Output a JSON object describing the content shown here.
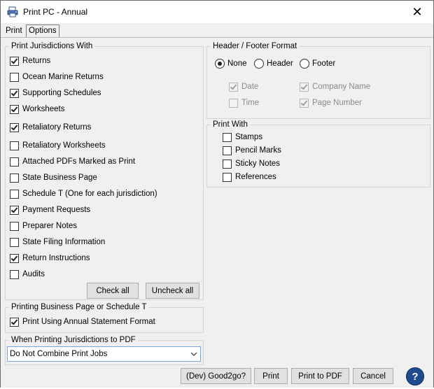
{
  "window": {
    "title": "Print PC - Annual"
  },
  "tabs": [
    {
      "label": "Print"
    },
    {
      "label": "Options"
    }
  ],
  "jurisdictions": {
    "title": "Print Jurisdictions With",
    "items": [
      {
        "label": "Returns",
        "checked": true
      },
      {
        "label": "Ocean Marine Returns",
        "checked": false
      },
      {
        "label": "Supporting Schedules",
        "checked": true
      },
      {
        "label": "Worksheets",
        "checked": true
      },
      {
        "label": "Retaliatory Returns",
        "checked": true
      },
      {
        "label": "Retaliatory Worksheets",
        "checked": false
      },
      {
        "label": "Attached PDFs Marked as Print",
        "checked": false
      },
      {
        "label": "State Business Page",
        "checked": false
      },
      {
        "label": "Schedule T (One for each jurisdiction)",
        "checked": false
      },
      {
        "label": "Payment Requests",
        "checked": true
      },
      {
        "label": "Preparer Notes",
        "checked": false
      },
      {
        "label": "State Filing Information",
        "checked": false
      },
      {
        "label": "Return Instructions",
        "checked": true
      },
      {
        "label": "Audits",
        "checked": false
      }
    ],
    "check_all": "Check all",
    "uncheck_all": "Uncheck all"
  },
  "business_page": {
    "title": "Printing Business Page or Schedule T",
    "option": {
      "label": "Print Using Annual Statement Format",
      "checked": true
    }
  },
  "pdf": {
    "title": "When Printing Jurisdictions to PDF",
    "selected": "Do Not Combine Print Jobs"
  },
  "header_footer": {
    "title": "Header / Footer Format",
    "radios": [
      {
        "label": "None",
        "selected": true
      },
      {
        "label": "Header",
        "selected": false
      },
      {
        "label": "Footer",
        "selected": false
      }
    ],
    "fields": [
      {
        "label": "Date",
        "checked": true
      },
      {
        "label": "Company Name",
        "checked": true
      },
      {
        "label": "Time",
        "checked": false
      },
      {
        "label": "Page Number",
        "checked": true
      }
    ]
  },
  "print_with": {
    "title": "Print With",
    "items": [
      {
        "label": "Stamps",
        "checked": false
      },
      {
        "label": "Pencil Marks",
        "checked": false
      },
      {
        "label": "Sticky Notes",
        "checked": false
      },
      {
        "label": "References",
        "checked": false
      }
    ]
  },
  "footer_buttons": {
    "dev": "(Dev) Good2go?",
    "print": "Print",
    "print_pdf": "Print to PDF",
    "cancel": "Cancel",
    "help": "?"
  },
  "colors": {
    "help_blue": "#1f4a8c",
    "select_border": "#7aa6d8"
  },
  "icons": {
    "app": "printer-app-icon",
    "close": "close-icon",
    "dropdown": "chevron-down-icon",
    "help": "help-icon"
  }
}
